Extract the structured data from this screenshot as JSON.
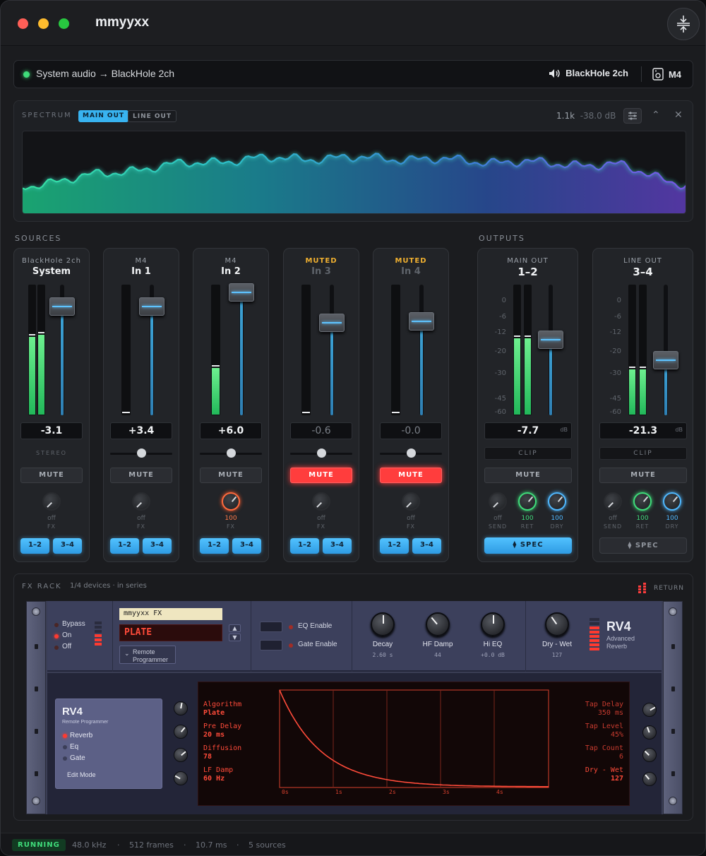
{
  "app": {
    "title": "mmyyxx"
  },
  "route": {
    "source": "System audio → BlackHole 2ch",
    "output": "BlackHole 2ch",
    "device": "M4"
  },
  "spectrum": {
    "label": "SPECTRUM",
    "tabs": [
      {
        "label": "MAIN OUT",
        "active": true
      },
      {
        "label": "LINE OUT",
        "active": false
      }
    ],
    "freq": "1.1k",
    "level": "-38.0 dB"
  },
  "sections": {
    "sources": "SOURCES",
    "outputs": "OUTPUTS"
  },
  "sources": [
    {
      "top": "BlackHole 2ch",
      "name": "System",
      "value": "-3.1",
      "sub": "STEREO",
      "mute": "MUTE",
      "muted": false,
      "fx_value": "off",
      "fx_label": "FX",
      "bus_a": "1–2",
      "bus_b": "3–4",
      "meter_l": 0.6,
      "meter_r": 0.62,
      "fader": 0.83
    },
    {
      "top": "M4",
      "name": "In 1",
      "value": "+3.4",
      "sub": "",
      "mute": "MUTE",
      "muted": false,
      "fx_value": "off",
      "fx_label": "FX",
      "bus_a": "1–2",
      "bus_b": "3–4",
      "meter_l": 0.0,
      "meter_r": null,
      "fader": 0.83
    },
    {
      "top": "M4",
      "name": "In 2",
      "value": "+6.0",
      "sub": "",
      "mute": "MUTE",
      "muted": false,
      "fx_value": "100",
      "fx_label": "FX",
      "bus_a": "1–2",
      "bus_b": "3–4",
      "meter_l": 0.36,
      "meter_r": null,
      "fader": 0.94
    },
    {
      "top": "MUTED",
      "name": "In 3",
      "value": "-0.6",
      "sub": "",
      "mute": "MUTE",
      "muted": true,
      "fx_value": "off",
      "fx_label": "FX",
      "bus_a": "1–2",
      "bus_b": "3–4",
      "meter_l": 0.0,
      "meter_r": null,
      "fader": 0.71
    },
    {
      "top": "MUTED",
      "name": "In 4",
      "value": "-0.0",
      "sub": "",
      "mute": "MUTE",
      "muted": true,
      "fx_value": "off",
      "fx_label": "FX",
      "bus_a": "1–2",
      "bus_b": "3–4",
      "meter_l": 0.0,
      "meter_r": null,
      "fader": 0.72
    }
  ],
  "outputs": [
    {
      "top": "MAIN OUT",
      "name": "1–2",
      "value": "-7.7",
      "unit": "dB",
      "clip": "CLIP",
      "mute": "MUTE",
      "spec": "SPEC",
      "spec_active": true,
      "meter_l": 0.59,
      "meter_r": 0.59,
      "fader": 0.58,
      "knobs": [
        {
          "value": "off",
          "label": "SEND"
        },
        {
          "value": "100",
          "label": "RET"
        },
        {
          "value": "100",
          "label": "DRY"
        }
      ]
    },
    {
      "top": "LINE OUT",
      "name": "3–4",
      "value": "-21.3",
      "unit": "dB",
      "clip": "CLIP",
      "mute": "MUTE",
      "spec": "SPEC",
      "spec_active": false,
      "meter_l": 0.35,
      "meter_r": 0.35,
      "fader": 0.42,
      "knobs": [
        {
          "value": "off",
          "label": "SEND"
        },
        {
          "value": "100",
          "label": "RET"
        },
        {
          "value": "100",
          "label": "DRY"
        }
      ]
    }
  ],
  "scale_ticks": [
    "0",
    "-6",
    "-12",
    "-20",
    "-30",
    "-45",
    "-60"
  ],
  "fx_rack": {
    "label": "FX RACK",
    "count": "1/4 devices · in series",
    "return": "RETURN",
    "device": {
      "modes": [
        "Bypass",
        "On",
        "Off"
      ],
      "preset_name": "mmyyxx FX",
      "program": "PLATE",
      "remote": "Remote\nProgrammer",
      "eq": "EQ Enable",
      "gate": "Gate Enable",
      "knobs": [
        {
          "label": "Decay",
          "value": "2.60 s"
        },
        {
          "label": "HF Damp",
          "value": "44"
        },
        {
          "label": "Hi EQ",
          "value": "+0.0 dB"
        },
        {
          "label": "Dry - Wet",
          "value": "127"
        }
      ],
      "model": "RV4",
      "model_sub": "Advanced\nReverb",
      "panel": {
        "title": "RV4",
        "sub": "Remote Programmer",
        "items": [
          "Reverb",
          "Eq",
          "Gate"
        ],
        "edit": "Edit Mode"
      },
      "display_left": [
        {
          "label": "Algorithm",
          "value": "Plate"
        },
        {
          "label": "Pre Delay",
          "value": "20 ms"
        },
        {
          "label": "Diffusion",
          "value": "78"
        },
        {
          "label": "LF Damp",
          "value": "60 Hz"
        }
      ],
      "display_right": [
        {
          "label": "Tap Delay",
          "value": "350 ms"
        },
        {
          "label": "Tap Level",
          "value": "45%"
        },
        {
          "label": "Tap Count",
          "value": "6"
        },
        {
          "label": "Dry - Wet",
          "value": "127"
        }
      ],
      "time_axis": [
        "0s",
        "1s",
        "2s",
        "3s",
        "4s"
      ]
    }
  },
  "status": {
    "state": "RUNNING",
    "rate": "48.0 kHz",
    "frames": "512 frames",
    "latency": "10.7 ms",
    "sources": "5 sources"
  }
}
